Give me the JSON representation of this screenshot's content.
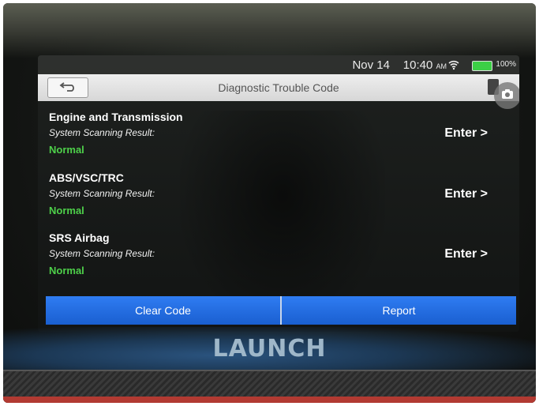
{
  "status_bar": {
    "date": "Nov 14",
    "time": "10:40",
    "ampm": "AM",
    "battery_percent": "100%",
    "icons": [
      "wifi-icon",
      "battery-icon"
    ]
  },
  "header": {
    "title": "Diagnostic Trouble Code",
    "back_icon": "back-arrow-icon",
    "doc_icon": "document-icon",
    "camera_icon": "camera-icon"
  },
  "systems": [
    {
      "name": "Engine and Transmission",
      "result_label": "System Scanning Result:",
      "status": "Normal",
      "action": "Enter >"
    },
    {
      "name": "ABS/VSC/TRC",
      "result_label": "System Scanning Result:",
      "status": "Normal",
      "action": "Enter >"
    },
    {
      "name": "SRS Airbag",
      "result_label": "System Scanning Result:",
      "status": "Normal",
      "action": "Enter >"
    }
  ],
  "footer": {
    "clear_code": "Clear Code",
    "report": "Report"
  },
  "device": {
    "brand": "LAUNCH"
  },
  "colors": {
    "status_normal": "#4ed04a",
    "button_blue": "#1a5fd0",
    "title_bar": "#e2e2e2",
    "battery_green": "#3ccf46"
  }
}
